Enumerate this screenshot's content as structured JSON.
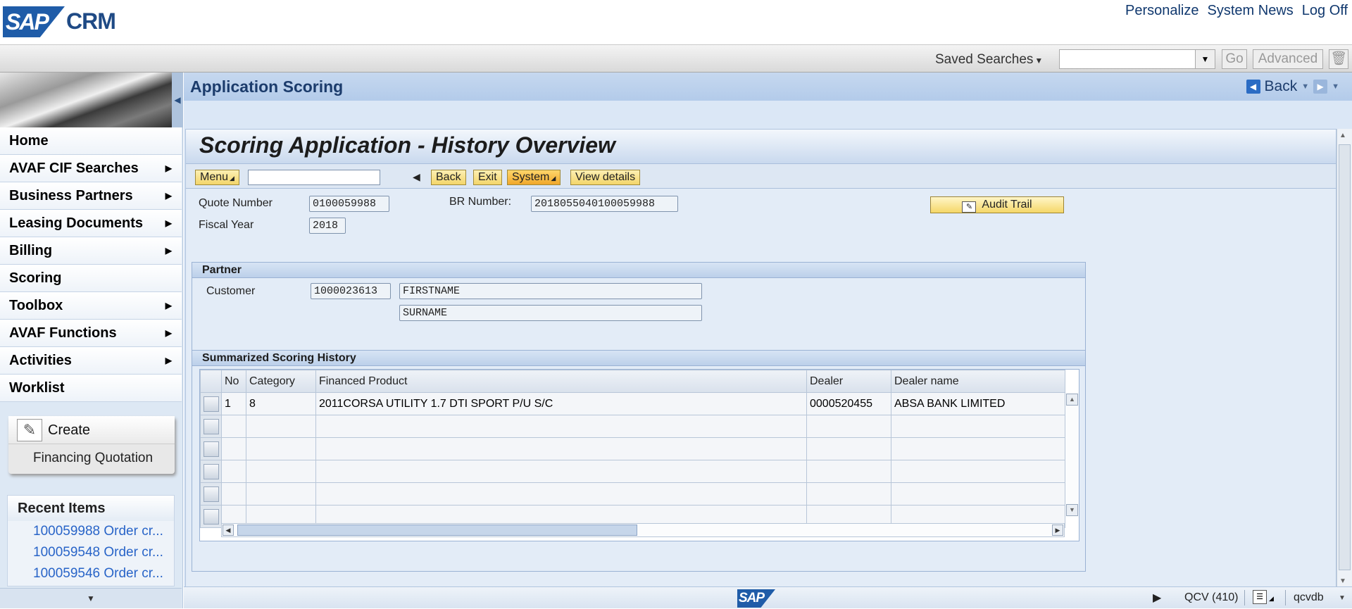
{
  "header": {
    "logo": "SAP",
    "product": "CRM",
    "links": [
      "Personalize",
      "System News",
      "Log Off"
    ]
  },
  "search": {
    "saved_searches_label": "Saved Searches",
    "value": "",
    "go_label": "Go",
    "advanced_label": "Advanced"
  },
  "nav": {
    "items": [
      {
        "label": "Home"
      },
      {
        "label": "AVAF CIF Searches"
      },
      {
        "label": "Business Partners"
      },
      {
        "label": "Leasing Documents"
      },
      {
        "label": "Billing"
      },
      {
        "label": "Scoring"
      },
      {
        "label": "Toolbox"
      },
      {
        "label": "AVAF Functions"
      },
      {
        "label": "Activities"
      },
      {
        "label": "Worklist"
      }
    ],
    "create": {
      "title": "Create",
      "items": [
        "Financing Quotation"
      ]
    },
    "recent": {
      "title": "Recent Items",
      "items": [
        "100059988 Order cr...",
        "100059548 Order cr...",
        "100059546 Order cr..."
      ]
    }
  },
  "page": {
    "title": "Application Scoring",
    "back_label": "Back"
  },
  "gui": {
    "title": "Scoring Application - History Overview",
    "toolbar": {
      "menu": "Menu",
      "command_value": "",
      "back": "Back",
      "exit": "Exit",
      "system": "System",
      "view_details": "View details"
    },
    "fields": {
      "quote_number_label": "Quote Number",
      "quote_number": "0100059988",
      "fiscal_year_label": "Fiscal Year",
      "fiscal_year": "2018",
      "br_number_label": "BR Number:",
      "br_number": "2018055040100059988",
      "audit_trail": "Audit Trail"
    },
    "partner": {
      "title": "Partner",
      "customer_label": "Customer",
      "customer_id": "1000023613",
      "first_name": "FIRSTNAME",
      "surname": "SURNAME"
    },
    "history": {
      "title": "Summarized Scoring History",
      "columns": [
        "No",
        "Category",
        "Financed Product",
        "Dealer",
        "Dealer name"
      ],
      "rows": [
        [
          "1",
          "8",
          "2011CORSA UTILITY 1.7 DTI SPORT P/U S/C",
          "0000520455",
          "ABSA BANK LIMITED"
        ],
        [
          "",
          "",
          "",
          "",
          ""
        ],
        [
          "",
          "",
          "",
          "",
          ""
        ],
        [
          "",
          "",
          "",
          "",
          ""
        ],
        [
          "",
          "",
          "",
          "",
          ""
        ],
        [
          "",
          "",
          "",
          "",
          ""
        ]
      ]
    }
  },
  "status": {
    "brand": "SAP",
    "system": "QCV (410)",
    "host": "qcvdb"
  }
}
